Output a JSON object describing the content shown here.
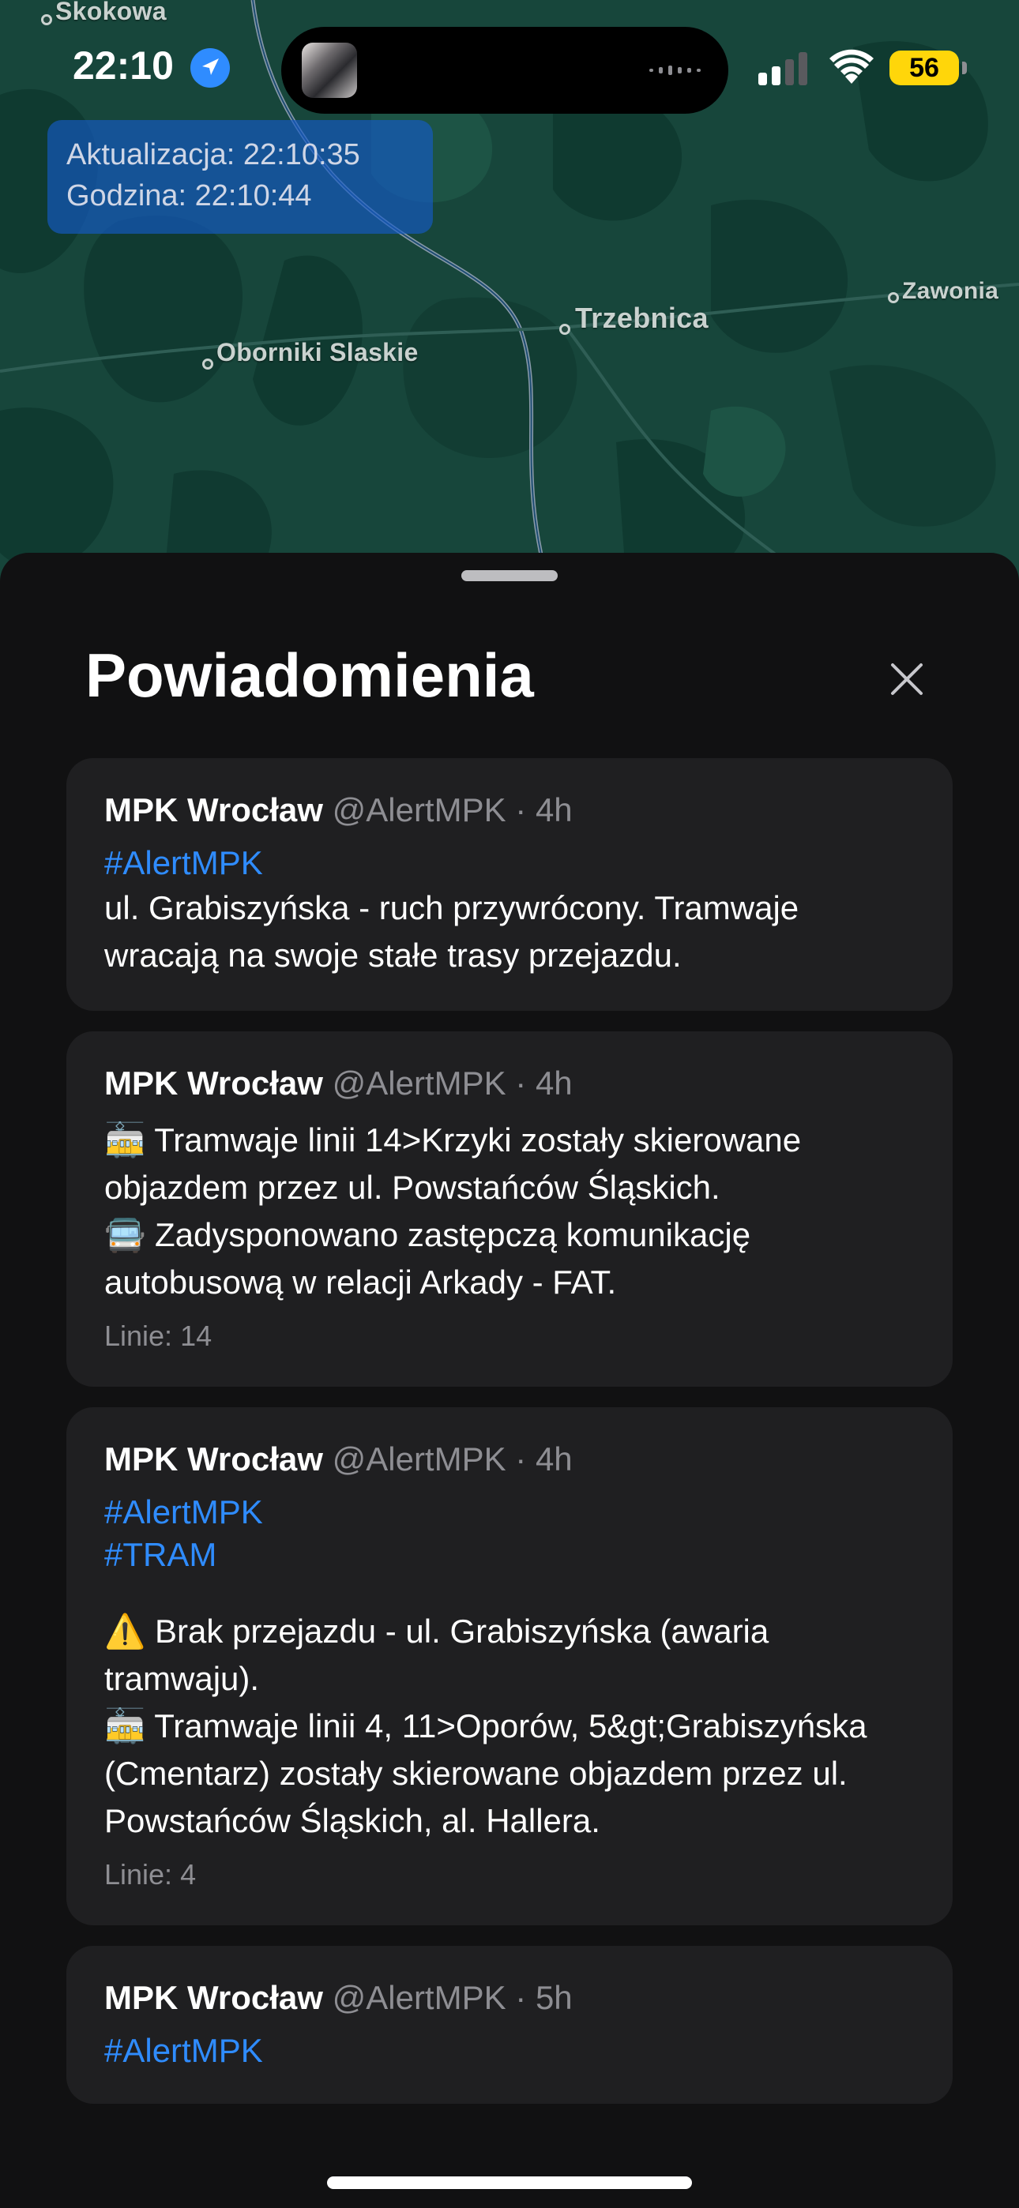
{
  "status_bar": {
    "time": "22:10",
    "battery": "56"
  },
  "map": {
    "update_line": "Aktualizacja: 22:10:35",
    "time_line": "Godzina: 22:10:44",
    "places": [
      "Skokowa",
      "Trzebnica",
      "Zawonia",
      "Oborniki Slaskie"
    ]
  },
  "sheet": {
    "title": "Powiadomienia",
    "close_icon": "close-icon"
  },
  "notifications": [
    {
      "author": "MPK Wrocław",
      "meta": "@AlertMPK · 4h",
      "tags": [
        "#AlertMPK"
      ],
      "message": "ul. Grabiszyńska - ruch przywrócony. Tramwaje wracają na swoje stałe trasy przejazdu.",
      "lines": ""
    },
    {
      "author": "MPK Wrocław",
      "meta": "@AlertMPK · 4h",
      "tags": [],
      "message": "🚋 Tramwaje linii 14>Krzyki zostały skierowane objazdem przez ul. Powstańców Śląskich.\n🚍 Zadysponowano zastępczą komunikację autobusową w relacji Arkady - FAT.",
      "lines": "Linie: 14"
    },
    {
      "author": "MPK Wrocław",
      "meta": "@AlertMPK · 4h",
      "tags": [
        "#AlertMPK",
        "#TRAM"
      ],
      "message": "⚠️ Brak przejazdu - ul. Grabiszyńska (awaria tramwaju).\n🚋 Tramwaje linii 4, 11>Oporów, 5&gt;Grabiszyńska (Cmentarz) zostały skierowane objazdem przez ul. Powstańców Śląskich, al. Hallera.",
      "lines": "Linie: 4",
      "blank_line_before_message": true
    },
    {
      "author": "MPK Wrocław",
      "meta": "@AlertMPK · 5h",
      "tags": [
        "#AlertMPK"
      ],
      "message": "",
      "lines": ""
    }
  ],
  "colors": {
    "accent_link": "#2f8cff",
    "battery": "#ffd60a",
    "sheet_bg": "#111112",
    "card_bg": "#1f1f21",
    "map_bg": "#17463b"
  }
}
